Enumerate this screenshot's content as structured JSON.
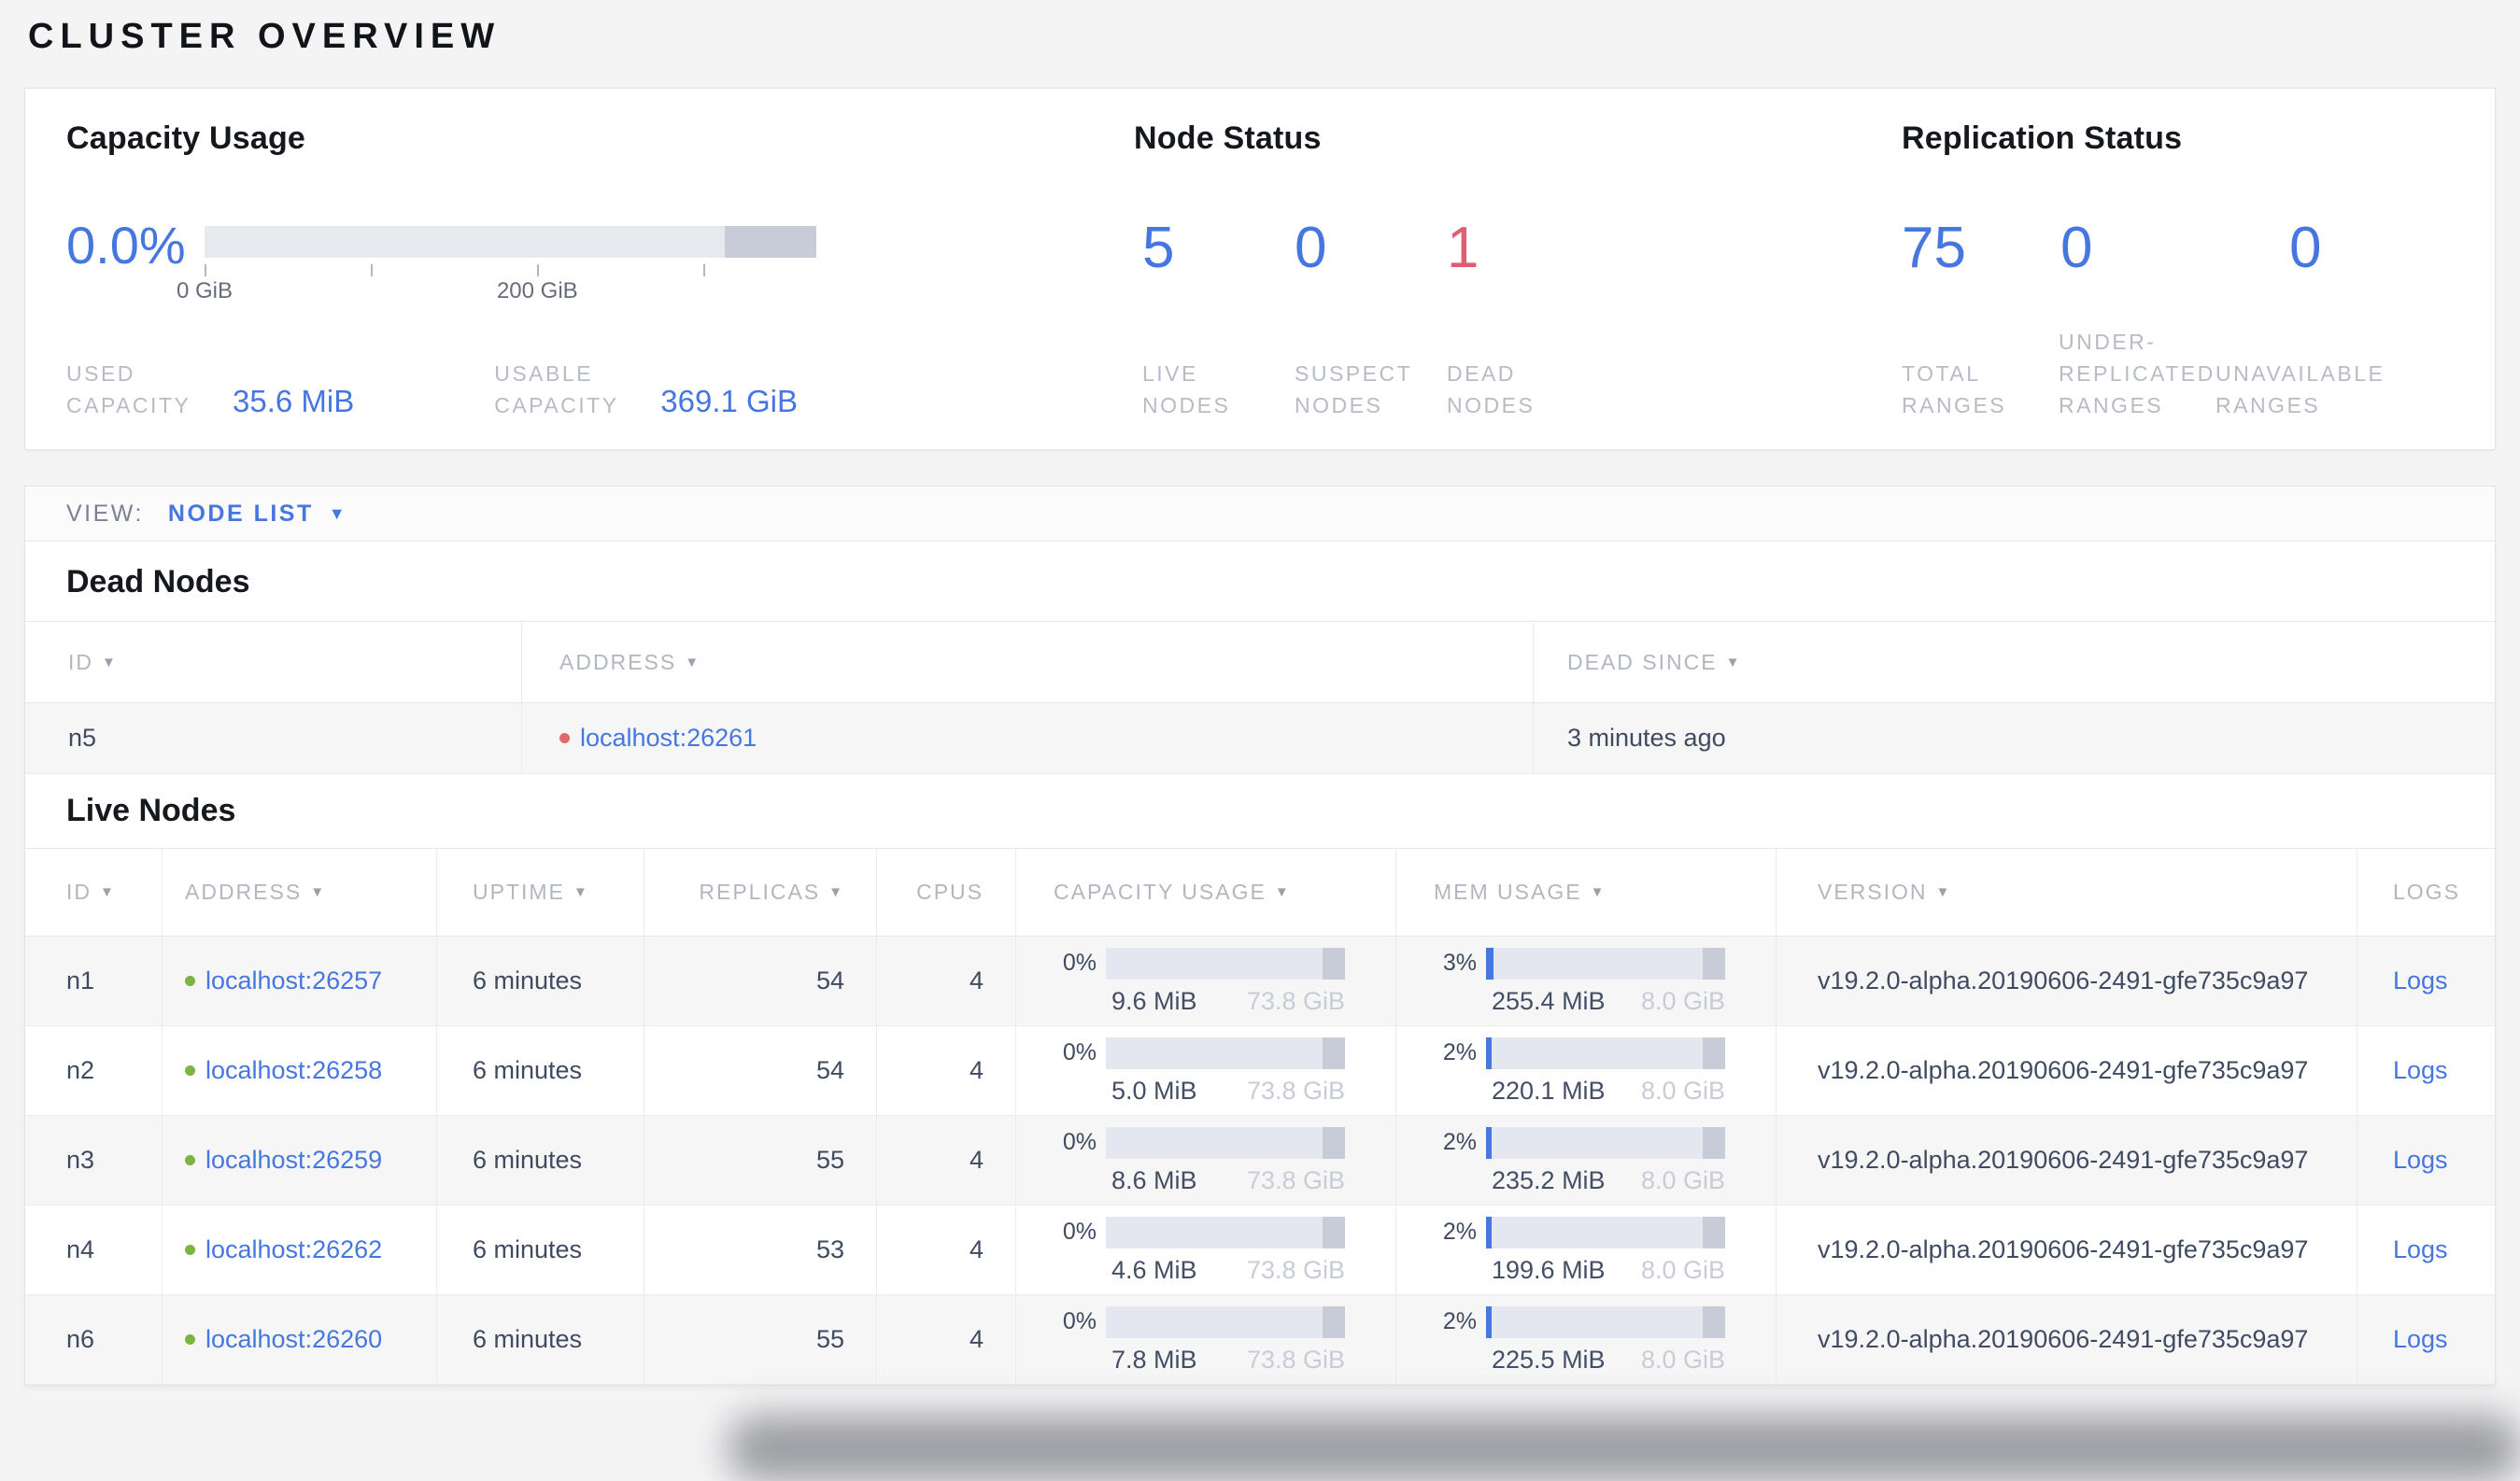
{
  "page_title": "CLUSTER OVERVIEW",
  "summary": {
    "capacity": {
      "heading": "Capacity Usage",
      "percent": "0.0%",
      "axis": {
        "tick_start": "0 GiB",
        "tick_mid": "200 GiB"
      },
      "stats": [
        {
          "label": "USED CAPACITY",
          "value": "35.6 MiB"
        },
        {
          "label": "USABLE CAPACITY",
          "value": "369.1 GiB"
        }
      ]
    },
    "node_status": {
      "heading": "Node Status",
      "items": [
        {
          "value": "5",
          "label": "LIVE NODES"
        },
        {
          "value": "0",
          "label": "SUSPECT NODES"
        },
        {
          "value": "1",
          "label": "DEAD NODES"
        }
      ]
    },
    "replication": {
      "heading": "Replication Status",
      "items": [
        {
          "value": "75",
          "label": "TOTAL RANGES"
        },
        {
          "value": "0",
          "label": "UNDER-REPLICATED RANGES"
        },
        {
          "value": "0",
          "label": "UNAVAILABLE RANGES"
        }
      ]
    }
  },
  "view_bar": {
    "label": "VIEW:",
    "selected": "NODE LIST"
  },
  "dead_nodes": {
    "heading": "Dead Nodes",
    "headers": {
      "id": "ID",
      "address": "ADDRESS",
      "dead_since": "DEAD SINCE"
    },
    "rows": [
      {
        "id": "n5",
        "address": "localhost:26261",
        "dead_since": "3 minutes ago"
      }
    ]
  },
  "live_nodes": {
    "heading": "Live Nodes",
    "headers": {
      "id": "ID",
      "address": "ADDRESS",
      "uptime": "UPTIME",
      "replicas": "REPLICAS",
      "cpus": "CPUS",
      "capacity": "CAPACITY USAGE",
      "memory": "MEM USAGE",
      "version": "VERSION",
      "logs": "LOGS"
    },
    "rows": [
      {
        "id": "n1",
        "address": "localhost:26257",
        "uptime": "6 minutes",
        "replicas": "54",
        "cpus": "4",
        "capacity": {
          "percent": "0%",
          "used": "9.6 MiB",
          "total": "73.8 GiB",
          "fill": 0
        },
        "memory": {
          "percent": "3%",
          "used": "255.4 MiB",
          "total": "8.0 GiB",
          "fill": 3
        },
        "version": "v19.2.0-alpha.20190606-2491-gfe735c9a97",
        "logs": "Logs"
      },
      {
        "id": "n2",
        "address": "localhost:26258",
        "uptime": "6 minutes",
        "replicas": "54",
        "cpus": "4",
        "capacity": {
          "percent": "0%",
          "used": "5.0 MiB",
          "total": "73.8 GiB",
          "fill": 0
        },
        "memory": {
          "percent": "2%",
          "used": "220.1 MiB",
          "total": "8.0 GiB",
          "fill": 2.5
        },
        "version": "v19.2.0-alpha.20190606-2491-gfe735c9a97",
        "logs": "Logs"
      },
      {
        "id": "n3",
        "address": "localhost:26259",
        "uptime": "6 minutes",
        "replicas": "55",
        "cpus": "4",
        "capacity": {
          "percent": "0%",
          "used": "8.6 MiB",
          "total": "73.8 GiB",
          "fill": 0
        },
        "memory": {
          "percent": "2%",
          "used": "235.2 MiB",
          "total": "8.0 GiB",
          "fill": 2.5
        },
        "version": "v19.2.0-alpha.20190606-2491-gfe735c9a97",
        "logs": "Logs"
      },
      {
        "id": "n4",
        "address": "localhost:26262",
        "uptime": "6 minutes",
        "replicas": "53",
        "cpus": "4",
        "capacity": {
          "percent": "0%",
          "used": "4.6 MiB",
          "total": "73.8 GiB",
          "fill": 0
        },
        "memory": {
          "percent": "2%",
          "used": "199.6 MiB",
          "total": "8.0 GiB",
          "fill": 2.5
        },
        "version": "v19.2.0-alpha.20190606-2491-gfe735c9a97",
        "logs": "Logs"
      },
      {
        "id": "n6",
        "address": "localhost:26260",
        "uptime": "6 minutes",
        "replicas": "55",
        "cpus": "4",
        "capacity": {
          "percent": "0%",
          "used": "7.8 MiB",
          "total": "73.8 GiB",
          "fill": 0
        },
        "memory": {
          "percent": "2%",
          "used": "225.5 MiB",
          "total": "8.0 GiB",
          "fill": 2.5
        },
        "version": "v19.2.0-alpha.20190606-2491-gfe735c9a97",
        "logs": "Logs"
      }
    ]
  },
  "colors": {
    "accent_blue": "#4677e0",
    "alert_red": "#df5f72",
    "healthy_green": "#7cb342"
  }
}
